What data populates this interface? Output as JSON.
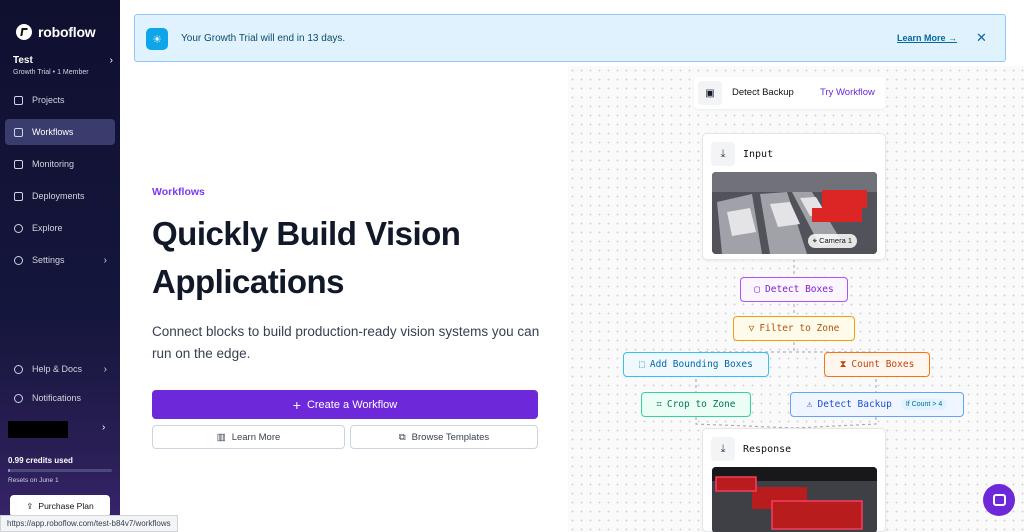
{
  "brand": {
    "name": "roboflow"
  },
  "workspace": {
    "name": "Test",
    "subtitle": "Growth Trial • 1 Member"
  },
  "sidebar": {
    "items": [
      {
        "label": "Projects",
        "icon": "folder-icon"
      },
      {
        "label": "Workflows",
        "icon": "workflow-icon",
        "active": true
      },
      {
        "label": "Monitoring",
        "icon": "chart-icon"
      },
      {
        "label": "Deployments",
        "icon": "server-icon"
      },
      {
        "label": "Explore",
        "icon": "compass-icon"
      },
      {
        "label": "Settings",
        "icon": "gear-icon"
      }
    ],
    "bottom": [
      {
        "label": "Help & Docs",
        "icon": "help-icon"
      },
      {
        "label": "Notifications",
        "icon": "bell-icon"
      }
    ],
    "credits": {
      "label": "0.99 credits used",
      "resets": "Resets on June 1",
      "fraction": 0.02
    },
    "purchase_label": "Purchase Plan"
  },
  "banner": {
    "text": "Your Growth Trial will end in 13 days.",
    "link": "Learn More →",
    "close": "✕"
  },
  "hero": {
    "eyebrow": "Workflows",
    "title": "Quickly Build Vision Applications",
    "description": "Connect blocks to build production-ready vision systems you can run on the edge.",
    "create_label": "Create a Workflow",
    "learn_more_label": "Learn More",
    "browse_label": "Browse Templates"
  },
  "preview": {
    "try_bar": {
      "label": "Detect Backup",
      "link": "Try Workflow"
    },
    "input_card": {
      "title": "Input",
      "camera": "Camera 1"
    },
    "response_card": {
      "title": "Response"
    },
    "nodes": {
      "detect": "Detect Boxes",
      "filter": "Filter to Zone",
      "bounding": "Add Bounding Boxes",
      "count": "Count Boxes",
      "crop": "Crop to Zone",
      "backup": "Detect Backup",
      "backup_badge": "If Count > 4"
    }
  },
  "status_bar": {
    "url": "https://app.roboflow.com/test-b84v7/workflows"
  },
  "colors": {
    "accent": "#6d28d9",
    "banner_bg": "#e0f2fe",
    "sidebar_bg": "#0f1030"
  }
}
